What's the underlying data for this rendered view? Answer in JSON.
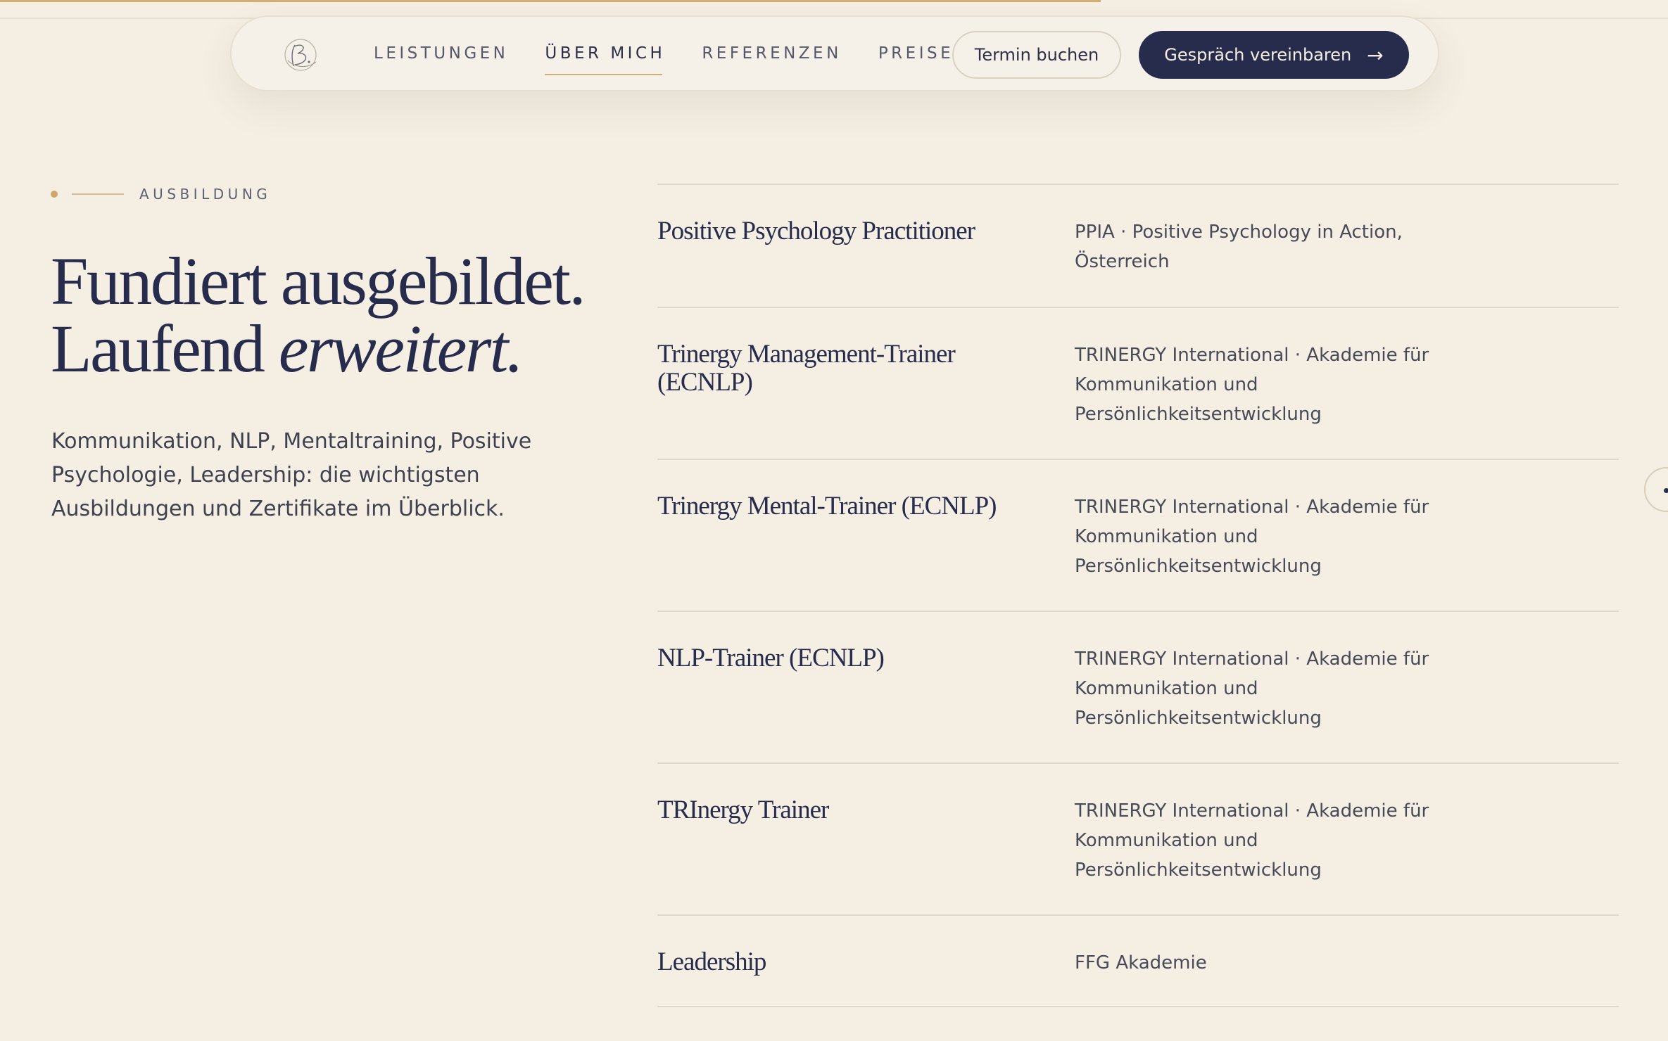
{
  "progress": {
    "fraction": 0.66,
    "color": "#d2ad74"
  },
  "nav": {
    "logo_icon": "script-b-monogram-icon",
    "links": [
      {
        "label": "LEISTUNGEN",
        "active": false
      },
      {
        "label": "ÜBER MICH",
        "active": true
      },
      {
        "label": "REFERENZEN",
        "active": false
      },
      {
        "label": "PREISE",
        "active": false
      }
    ],
    "secondary_button": "Termin buchen",
    "primary_button": "Gespräch vereinbaren",
    "primary_arrow": "→"
  },
  "section": {
    "eyebrow": "AUSBILDUNG",
    "headline_line1": "Fundiert ausgebildet.",
    "headline_line2_plain": "Laufend ",
    "headline_line2_italic": "erweitert.",
    "lead": "Kommunikation, NLP, Mentaltraining, Positive Psychologie, Leadership: die wichtigsten Ausbildungen und Zertifikate im Überblick."
  },
  "education": [
    {
      "title": "Positive Psychology Practitioner",
      "org": "PPIA · Positive Psychology in Action, Österreich"
    },
    {
      "title": "Trinergy Management-Trainer (ECNLP)",
      "org": "TRINERGY International · Akademie für Kommunikation und Persönlichkeitsentwicklung"
    },
    {
      "title": "Trinergy Mental-Trainer (ECNLP)",
      "org": "TRINERGY International · Akademie für Kommunikation und Persönlichkeitsentwicklung"
    },
    {
      "title": "NLP-Trainer (ECNLP)",
      "org": "TRINERGY International · Akademie für Kommunikation und Persönlichkeitsentwicklung"
    },
    {
      "title": "TRInergy Trainer",
      "org": "TRINERGY International · Akademie für Kommunikation und Persönlichkeitsentwicklung"
    },
    {
      "title": "Leadership",
      "org": "FFG Akademie"
    }
  ],
  "colors": {
    "background": "#f4eee3",
    "navy": "#272c4c",
    "gold": "#cfa56d"
  }
}
